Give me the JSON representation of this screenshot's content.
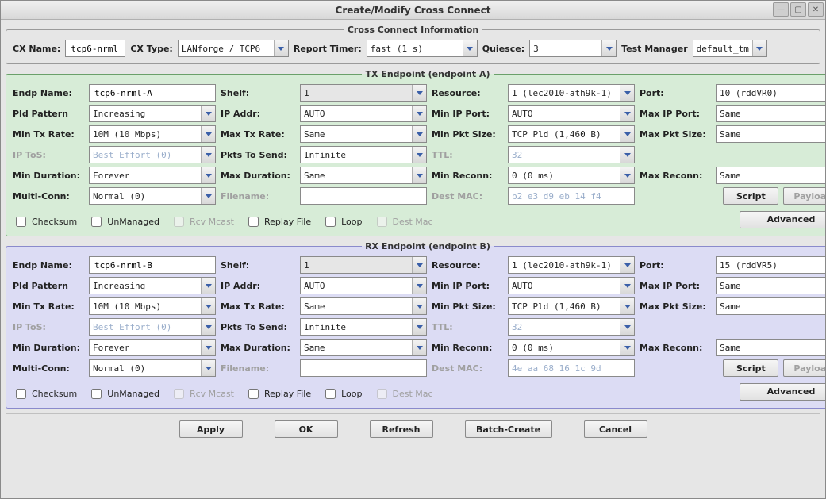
{
  "window": {
    "title": "Create/Modify Cross Connect"
  },
  "cci": {
    "legend": "Cross Connect Information",
    "cx_name_label": "CX Name:",
    "cx_name": "tcp6-nrml",
    "cx_type_label": "CX Type:",
    "cx_type": "LANforge / TCP6",
    "report_timer_label": "Report Timer:",
    "report_timer": "fast   (1 s)",
    "quiesce_label": "Quiesce:",
    "quiesce": "3",
    "test_manager_label": "Test Manager",
    "test_manager": "default_tm"
  },
  "tx": {
    "legend": "TX Endpoint (endpoint A)",
    "endp_name_label": "Endp Name:",
    "endp_name": "tcp6-nrml-A",
    "shelf_label": "Shelf:",
    "shelf": "1",
    "resource_label": "Resource:",
    "resource": "1 (lec2010-ath9k-1)",
    "port_label": "Port:",
    "port": "10 (rddVR0)",
    "pld_label": "Pld Pattern",
    "pld": "Increasing",
    "ipaddr_label": "IP Addr:",
    "ipaddr": "AUTO",
    "min_ip_port_label": "Min IP Port:",
    "min_ip_port": "AUTO",
    "max_ip_port_label": "Max IP Port:",
    "max_ip_port": "Same",
    "min_tx_label": "Min Tx Rate:",
    "min_tx": "10M    (10 Mbps)",
    "max_tx_label": "Max Tx Rate:",
    "max_tx": "Same",
    "min_pkt_label": "Min Pkt Size:",
    "min_pkt": "TCP Pld  (1,460 B)",
    "max_pkt_label": "Max Pkt Size:",
    "max_pkt": "Same",
    "ip_tos_label": "IP ToS:",
    "ip_tos": "Best Effort (0)",
    "pkts_send_label": "Pkts To Send:",
    "pkts_send": "Infinite",
    "ttl_label": "TTL:",
    "ttl": "32",
    "min_dur_label": "Min Duration:",
    "min_dur": "Forever",
    "max_dur_label": "Max Duration:",
    "max_dur": "Same",
    "min_reconn_label": "Min Reconn:",
    "min_reconn": "0    (0 ms)",
    "max_reconn_label": "Max Reconn:",
    "max_reconn": "Same",
    "multi_label": "Multi-Conn:",
    "multi": "Normal (0)",
    "filename_label": "Filename:",
    "filename": "",
    "dest_mac_label": "Dest MAC:",
    "dest_mac": "b2 e3 d9 eb 14 f4",
    "ck_checksum": "Checksum",
    "ck_unmanaged": "UnManaged",
    "ck_rcvmcast": "Rcv Mcast",
    "ck_replay": "Replay File",
    "ck_loop": "Loop",
    "ck_destmac": "Dest Mac",
    "btn_script": "Script",
    "btn_payload": "Payload",
    "btn_advanced": "Advanced"
  },
  "rx": {
    "legend": "RX Endpoint (endpoint B)",
    "endp_name_label": "Endp Name:",
    "endp_name": "tcp6-nrml-B",
    "shelf_label": "Shelf:",
    "shelf": "1",
    "resource_label": "Resource:",
    "resource": "1 (lec2010-ath9k-1)",
    "port_label": "Port:",
    "port": "15 (rddVR5)",
    "pld_label": "Pld Pattern",
    "pld": "Increasing",
    "ipaddr_label": "IP Addr:",
    "ipaddr": "AUTO",
    "min_ip_port_label": "Min IP Port:",
    "min_ip_port": "AUTO",
    "max_ip_port_label": "Max IP Port:",
    "max_ip_port": "Same",
    "min_tx_label": "Min Tx Rate:",
    "min_tx": "10M    (10 Mbps)",
    "max_tx_label": "Max Tx Rate:",
    "max_tx": "Same",
    "min_pkt_label": "Min Pkt Size:",
    "min_pkt": "TCP Pld  (1,460 B)",
    "max_pkt_label": "Max Pkt Size:",
    "max_pkt": "Same",
    "ip_tos_label": "IP ToS:",
    "ip_tos": "Best Effort (0)",
    "pkts_send_label": "Pkts To Send:",
    "pkts_send": "Infinite",
    "ttl_label": "TTL:",
    "ttl": "32",
    "min_dur_label": "Min Duration:",
    "min_dur": "Forever",
    "max_dur_label": "Max Duration:",
    "max_dur": "Same",
    "min_reconn_label": "Min Reconn:",
    "min_reconn": "0    (0 ms)",
    "max_reconn_label": "Max Reconn:",
    "max_reconn": "Same",
    "multi_label": "Multi-Conn:",
    "multi": "Normal (0)",
    "filename_label": "Filename:",
    "filename": "",
    "dest_mac_label": "Dest MAC:",
    "dest_mac": "4e aa 68 16 1c 9d",
    "ck_checksum": "Checksum",
    "ck_unmanaged": "UnManaged",
    "ck_rcvmcast": "Rcv Mcast",
    "ck_replay": "Replay File",
    "ck_loop": "Loop",
    "ck_destmac": "Dest Mac",
    "btn_script": "Script",
    "btn_payload": "Payload",
    "btn_advanced": "Advanced"
  },
  "footer": {
    "apply": "Apply",
    "ok": "OK",
    "refresh": "Refresh",
    "batch": "Batch-Create",
    "cancel": "Cancel"
  }
}
